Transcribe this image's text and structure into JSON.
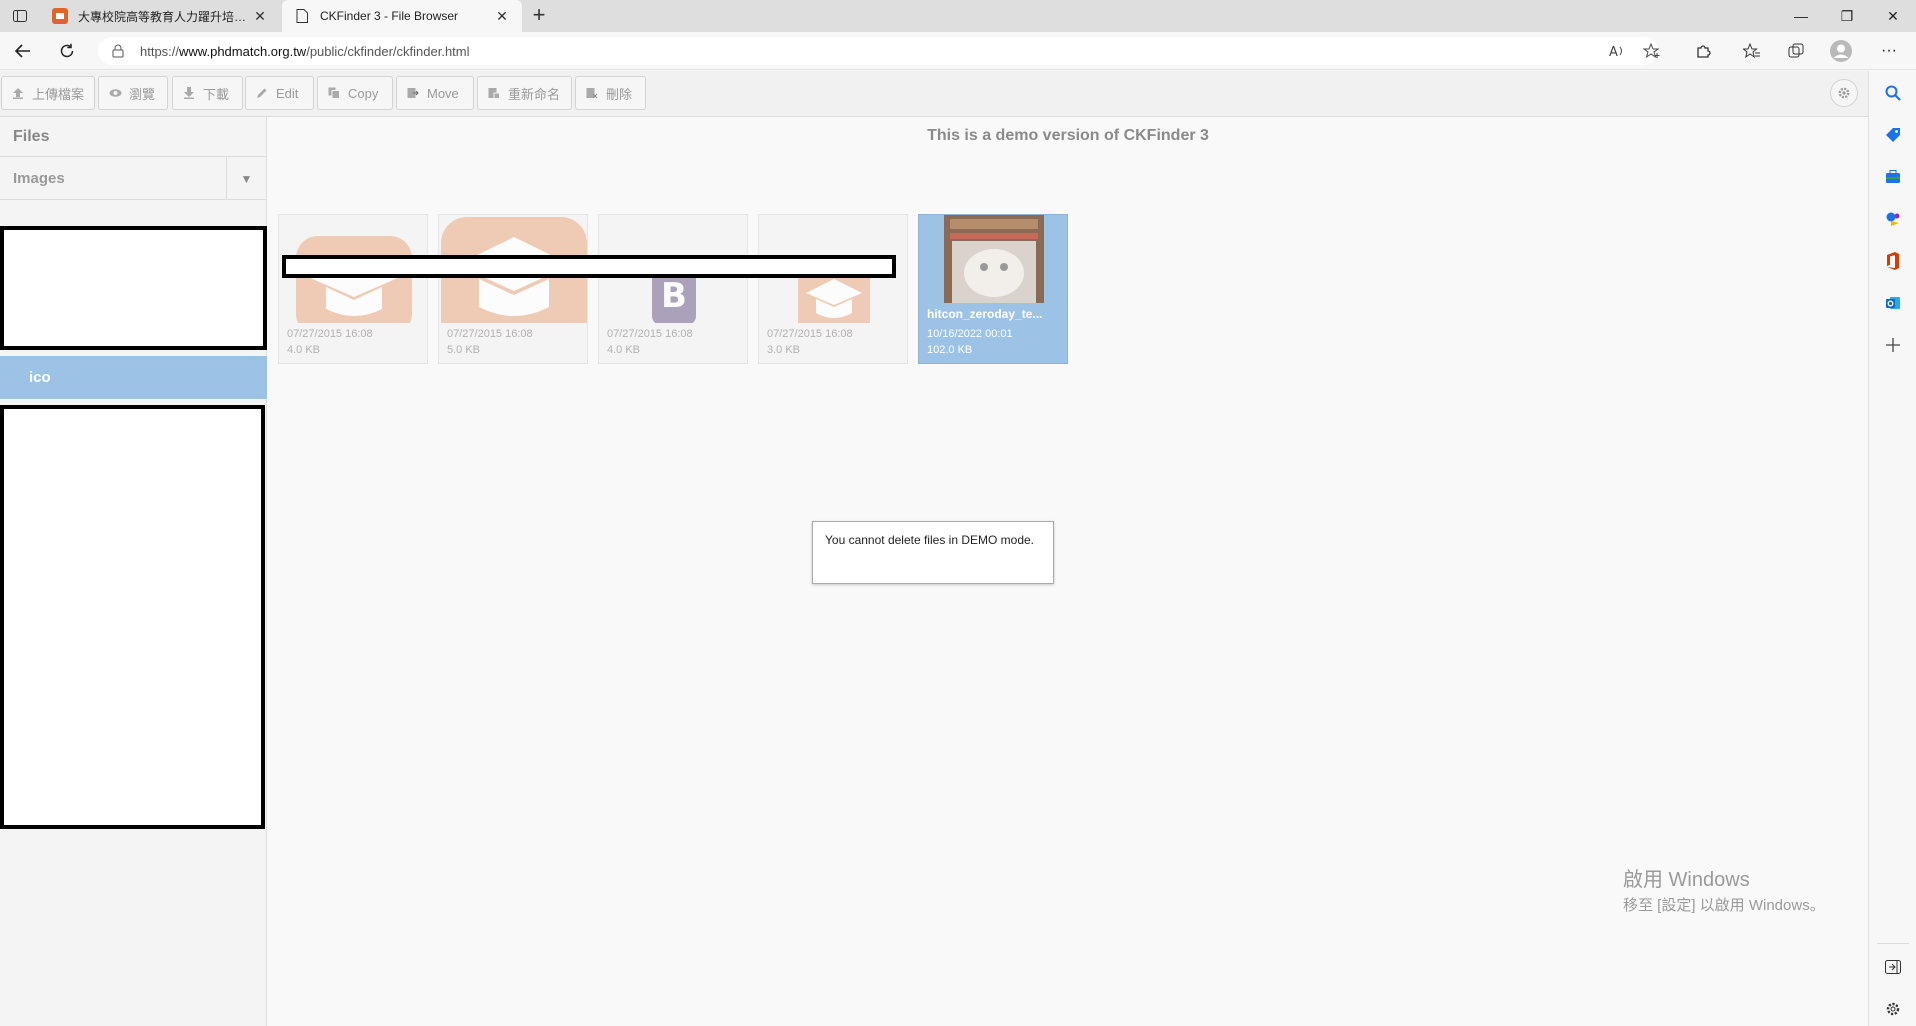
{
  "browser": {
    "tabs": [
      {
        "title": "大專校院高等教育人力躍升培訓計畫",
        "active": false
      },
      {
        "title": "CKFinder 3 - File Browser",
        "active": true
      }
    ],
    "new_tab_label": "+",
    "close_label": "✕",
    "url_prefix": "https://",
    "url_host": "www.phdmatch.org.tw",
    "url_path": "/public/ckfinder/ckfinder.html",
    "window_controls": {
      "minimize": "—",
      "restore": "❐",
      "close": "✕"
    },
    "more_label": "···"
  },
  "toolbar": {
    "buttons": [
      {
        "label": "上傳檔案",
        "icon": "upload-icon"
      },
      {
        "label": "瀏覽",
        "icon": "eye-icon"
      },
      {
        "label": "下載",
        "icon": "download-icon"
      },
      {
        "label": "Edit",
        "icon": "pencil-icon"
      },
      {
        "label": "Copy",
        "icon": "copy-icon"
      },
      {
        "label": "Move",
        "icon": "move-icon"
      },
      {
        "label": "重新命名",
        "icon": "rename-icon"
      },
      {
        "label": "刪除",
        "icon": "trash-icon"
      }
    ]
  },
  "sidebar": {
    "header": "Files",
    "resource_type": "Images",
    "dropdown_glyph": "▼",
    "selected_folder": "ico"
  },
  "main": {
    "demo_title": "This is a demo version of CKFinder 3",
    "files": [
      {
        "name": "",
        "date": "07/27/2015 16:08",
        "size": "4.0 KB",
        "selected": false
      },
      {
        "name": "",
        "date": "07/27/2015 16:08",
        "size": "5.0 KB",
        "selected": false
      },
      {
        "name": "",
        "date": "07/27/2015 16:08",
        "size": "4.0 KB",
        "selected": false
      },
      {
        "name": "",
        "date": "07/27/2015 16:08",
        "size": "3.0 KB",
        "selected": false
      },
      {
        "name": "hitcon_zeroday_te...",
        "date": "10/16/2022 00:01",
        "size": "102.0 KB",
        "selected": true
      }
    ],
    "notice": "You cannot delete files in DEMO mode.",
    "bootstrap_letter": "B"
  },
  "watermark": {
    "line1": "啟用 Windows",
    "line2": "移至 [設定] 以啟用 Windows。"
  },
  "colors": {
    "accent": "#9cc2e5",
    "edge_blue": "#1a73e8",
    "thumb_orange": "#e8a77e",
    "bootstrap_purple": "#6f5a8a"
  }
}
